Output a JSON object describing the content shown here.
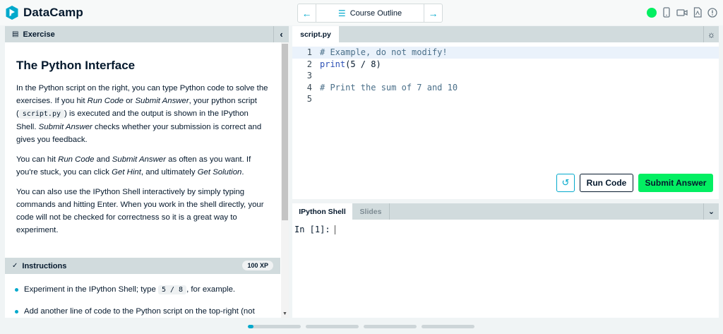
{
  "app": {
    "name": "DataCamp"
  },
  "nav": {
    "center_label": "Course Outline"
  },
  "exercise": {
    "header_label": "Exercise",
    "title": "The Python Interface",
    "p1_a": "In the Python script on the right, you can type Python code to solve the exercises. If you hit ",
    "p1_run": "Run Code",
    "p1_b": " or ",
    "p1_submit": "Submit Answer",
    "p1_c": ", your python script (",
    "p1_code": "script.py",
    "p1_d": ") is executed and the output is shown in the IPython Shell. ",
    "p1_submit2": "Submit Answer",
    "p1_e": " checks whether your submission is correct and gives you feedback.",
    "p2_a": "You can hit ",
    "p2_run": "Run Code",
    "p2_b": " and ",
    "p2_submit": "Submit Answer",
    "p2_c": " as often as you want. If you're stuck, you can click ",
    "p2_hint": "Get Hint",
    "p2_d": ", and ultimately ",
    "p2_solution": "Get Solution",
    "p2_e": ".",
    "p3": "You can also use the IPython Shell interactively by simply typing commands and hitting Enter. When you work in the shell directly, your code will not be checked for correctness so it is a great way to experiment."
  },
  "instructions": {
    "header_label": "Instructions",
    "xp": "100 XP",
    "i1_a": "Experiment in the IPython Shell; type ",
    "i1_code": "5 / 8",
    "i1_b": ", for example.",
    "i2": "Add another line of code to the Python script on the top-right (not"
  },
  "editor": {
    "tab": "script.py",
    "lines": [
      {
        "num": "1",
        "comment": "# Example, do not modify!"
      },
      {
        "num": "2",
        "kw": "print",
        "rest": "(5 / 8)"
      },
      {
        "num": "3"
      },
      {
        "num": "4",
        "comment": "# Print the sum of 7 and 10"
      },
      {
        "num": "5"
      }
    ],
    "run_label": "Run Code",
    "submit_label": "Submit Answer"
  },
  "shell": {
    "tab_active": "IPython Shell",
    "tab_inactive": "Slides",
    "prompt": "In [1]:"
  },
  "progress": {
    "segments": [
      0.1,
      0,
      0,
      0
    ]
  },
  "colors": {
    "brand_green": "#03ef62",
    "accent_blue": "#03a9cc",
    "navy": "#05192d"
  }
}
